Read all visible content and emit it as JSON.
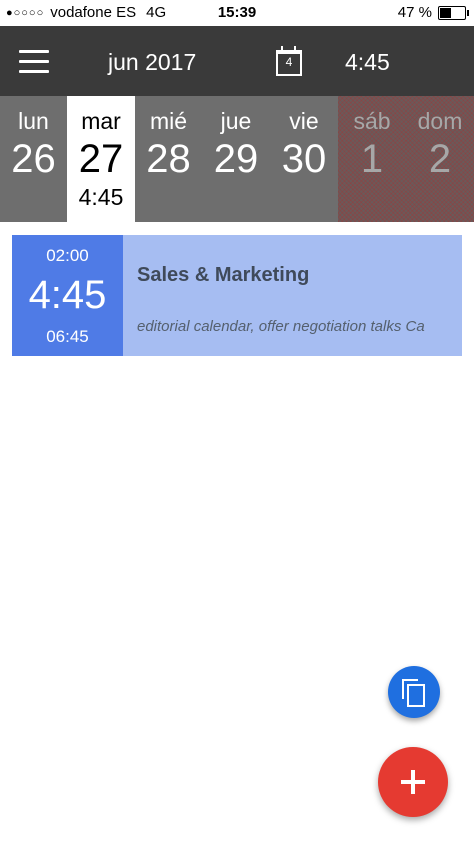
{
  "status_bar": {
    "signal": "●○○○○",
    "carrier": "vodafone ES",
    "network": "4G",
    "time": "15:39",
    "battery_percent": "47 %",
    "battery_level": 0.47
  },
  "header": {
    "month_title": "jun 2017",
    "today_day": "4",
    "time": "4:45"
  },
  "week": {
    "days": [
      {
        "name": "lun",
        "number": "26"
      },
      {
        "name": "mar",
        "number": "27",
        "time": "4:45"
      },
      {
        "name": "mié",
        "number": "28"
      },
      {
        "name": "jue",
        "number": "29"
      },
      {
        "name": "vie",
        "number": "30"
      },
      {
        "name": "sáb",
        "number": "1"
      },
      {
        "name": "dom",
        "number": "2"
      }
    ]
  },
  "event": {
    "start": "02:00",
    "duration": "4:45",
    "end": "06:45",
    "title": "Sales & Marketing",
    "description": "editorial calendar, offer negotiation talks Ca"
  },
  "colors": {
    "header_bg": "#3a3a3a",
    "week_bg": "#6e6e6e",
    "event_time_bg": "#4f7be6",
    "event_bg": "#a6bdf2",
    "fab_copy": "#1f6fe0",
    "fab_add": "#e53a31"
  }
}
